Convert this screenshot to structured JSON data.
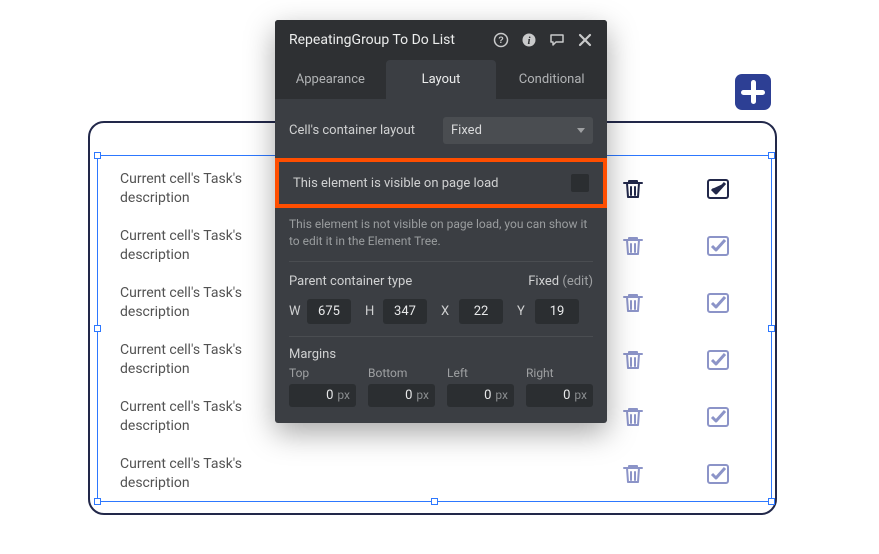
{
  "panel": {
    "title": "RepeatingGroup To Do List",
    "tabs": {
      "appearance": "Appearance",
      "layout": "Layout",
      "conditional": "Conditional",
      "active": "Layout"
    },
    "container_layout": {
      "label": "Cell's container layout",
      "value": "Fixed"
    },
    "visible": {
      "label": "This element is visible on page load",
      "help": "This element is not visible on page load, you can show it to edit it in the Element Tree.",
      "checked": false
    },
    "parent_container": {
      "label": "Parent container type",
      "value": "Fixed",
      "edit": "(edit)"
    },
    "dims": {
      "w_label": "W",
      "w": "675",
      "h_label": "H",
      "h": "347",
      "x_label": "X",
      "x": "22",
      "y_label": "Y",
      "y": "19"
    },
    "margins": {
      "section_label": "Margins",
      "top_label": "Top",
      "top": "0",
      "bottom_label": "Bottom",
      "bottom": "0",
      "left_label": "Left",
      "left": "0",
      "right_label": "Right",
      "right": "0",
      "unit": "px"
    }
  },
  "list": {
    "row_text": "Current cell's Task's description",
    "row_count": 6
  },
  "colors": {
    "strong": "#22284a",
    "muted": "#8c94c8",
    "highlight": "#ff4e00"
  }
}
